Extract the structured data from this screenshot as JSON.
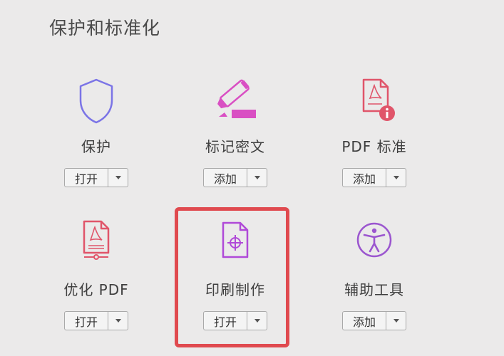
{
  "section": {
    "title": "保护和标准化"
  },
  "tools": [
    {
      "label": "保护",
      "button": "打开",
      "icon": "shield-icon"
    },
    {
      "label": "标记密文",
      "button": "添加",
      "icon": "marker-icon"
    },
    {
      "label": "PDF 标准",
      "button": "添加",
      "icon": "pdf-info-icon"
    },
    {
      "label": "优化 PDF",
      "button": "打开",
      "icon": "pdf-optimize-icon"
    },
    {
      "label": "印刷制作",
      "button": "打开",
      "icon": "print-production-icon"
    },
    {
      "label": "辅助工具",
      "button": "添加",
      "icon": "accessibility-icon"
    }
  ],
  "colors": {
    "shield": "#7b74e6",
    "marker": "#d94fc3",
    "pdf_red": "#e0556a",
    "print": "#b04ad8",
    "accessibility": "#9b56cf",
    "highlight": "#e04a4f"
  }
}
